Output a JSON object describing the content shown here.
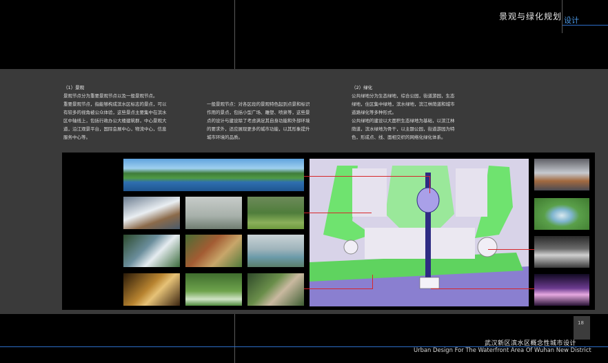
{
  "header": {
    "title": "景观与绿化规划",
    "subtitle": "设计"
  },
  "columns": [
    {
      "heading": "（1）景观",
      "lines": [
        "景观节点分为重要景观节点以及一般景观节点。",
        "重要景观节点，指能够构成滨水区标志的景点，可以",
        "有较多的视角被公众体验，这些景点主要集中在滨水",
        "区中轴线上，包括行政办公大楼建筑群，中心景观大",
        "道，沿江观景平台，国际会展中心，物流中心，信息",
        "服务中心等。"
      ]
    },
    {
      "heading": "",
      "lines": [
        "一般景观节点：对各区段的景观特色起到点景和标识",
        "作用的景点，包括小型广场、雕塑、喷泉等，这些景",
        "点的设计与建设除了考虑满足其自身功能和外部环境",
        "的要求外，还应展现更多的城市功能，以其形象提升",
        "城市环境的品质。"
      ]
    },
    {
      "heading": "（2）绿化",
      "lines": [
        "公共绿地分为生态绿地，综合公园，街道游园，生态",
        "绿地，住区集中绿地，滨水绿地，滨江林荫道和城市",
        "道路绿化等多种形式。",
        "公共绿地的建设以大面积生态绿地为基础，以滨江林",
        "荫道，滨水绿地为骨干，以主题公园，街道游园为特",
        "色，形成点、线、面相交织的网络化绿化体系。"
      ]
    }
  ],
  "page": {
    "number": "18"
  },
  "footer": {
    "title_cn": "武汉新区滨水区概念性城市设计",
    "title_en": "Urban Design For The Waterfront Area Of Wuhan New District"
  }
}
